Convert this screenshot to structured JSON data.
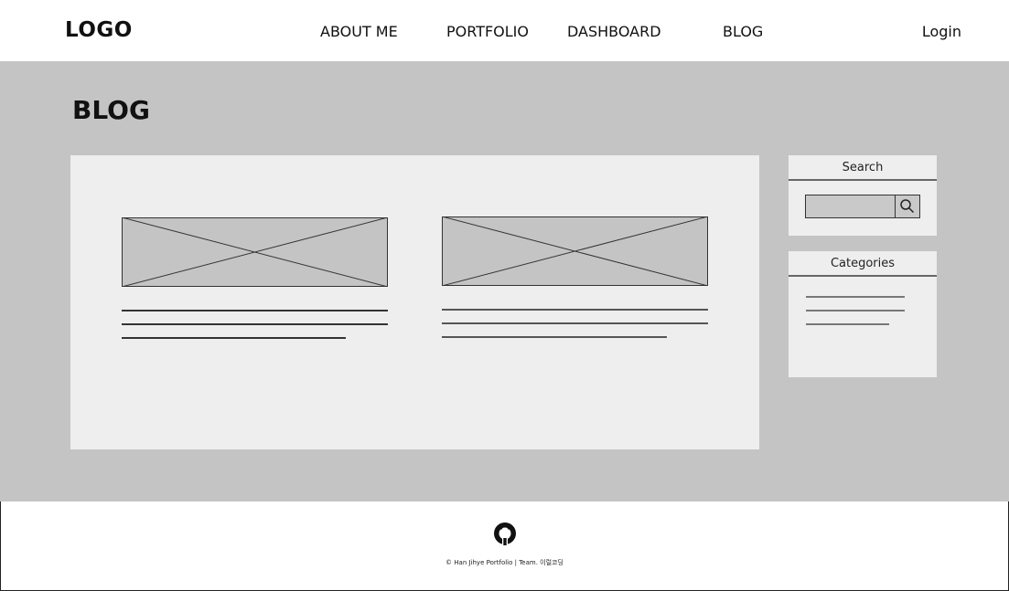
{
  "header": {
    "logo": "LOGO",
    "nav": [
      {
        "label": "ABOUT ME"
      },
      {
        "label": "PORTFOLIO"
      },
      {
        "label": "DASHBOARD"
      },
      {
        "label": "BLOG"
      }
    ],
    "login": "Login"
  },
  "main": {
    "title": "BLOG",
    "posts": [
      {
        "thumbnail": "image-placeholder"
      },
      {
        "thumbnail": "image-placeholder"
      }
    ]
  },
  "sidebar": {
    "search_title": "Search",
    "search_placeholder": "",
    "categories_title": "Categories"
  },
  "footer": {
    "icon": "github-icon",
    "copyright": "© Han Jihye Portfolio  |  Team. 이럴코딩"
  }
}
